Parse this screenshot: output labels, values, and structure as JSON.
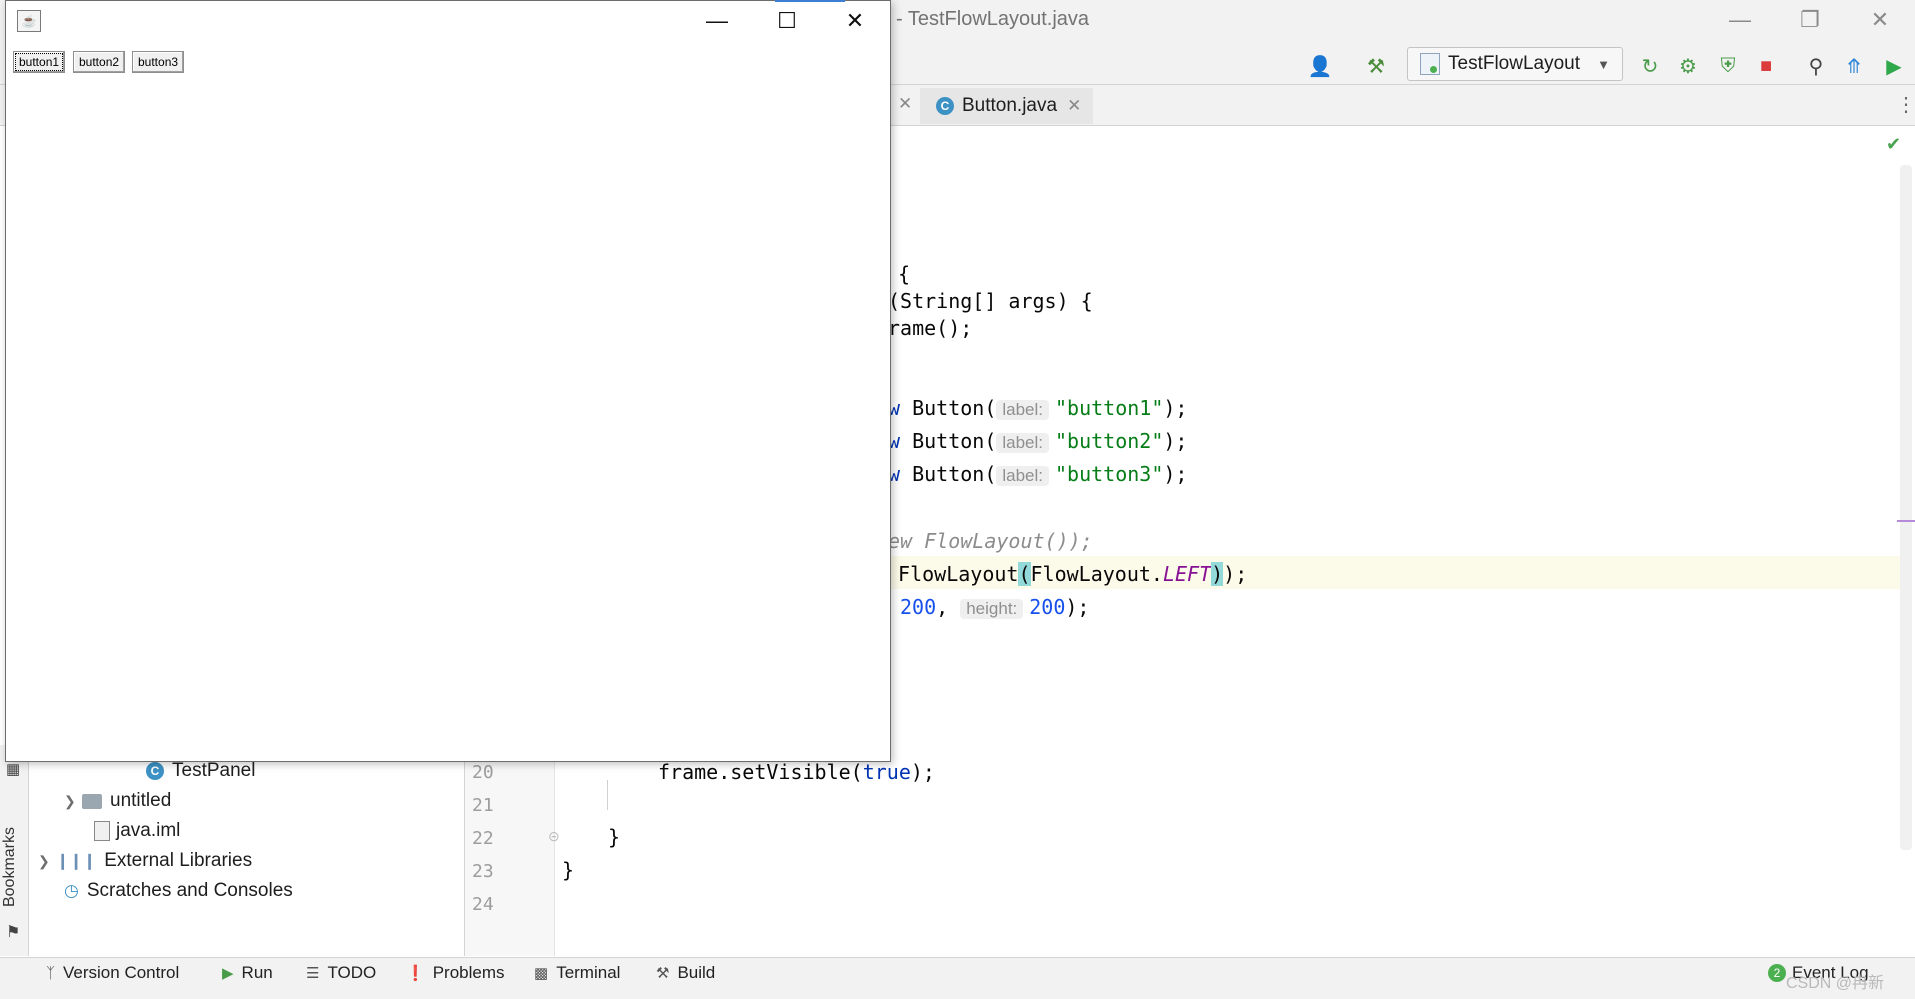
{
  "ide": {
    "title": "- TestFlowLayout.java",
    "run_config": "TestFlowLayout",
    "tab_label": "Button.java",
    "tab_icon": "C"
  },
  "code_lines": {
    "l1": "{",
    "l2": "(String[] args) {",
    "l3": "rame();",
    "b1_pre": "w",
    "b1_call": " Button(",
    "b1_hint": "label:",
    "b1_str": "\"button1\"",
    "b1_end": ");",
    "b2_pre": "w",
    "b2_call": " Button(",
    "b2_hint": "label:",
    "b2_str": "\"button2\"",
    "b2_end": ");",
    "b3_pre": "w",
    "b3_call": " Button(",
    "b3_hint": "label:",
    "b3_str": "\"button3\"",
    "b3_end": ");",
    "comment": "ew FlowLayout());",
    "fl_call": " FlowLayout",
    "fl_open": "(",
    "fl_arg": "FlowLayout.",
    "fl_const": "LEFT",
    "fl_close": ")",
    "fl_end": ");",
    "sz_num1": "200",
    "sz_sep": ", ",
    "sz_hint": "height:",
    "sz_num2": "200",
    "sz_end": ");",
    "vis_pre": "frame.setVisible(",
    "vis_kw": "true",
    "vis_end": ");",
    "close_inner": "}",
    "close_outer": "}"
  },
  "line_numbers": [
    "20",
    "21",
    "22",
    "23",
    "24"
  ],
  "project_tree": {
    "test_panel": "TestPanel",
    "untitled": "untitled",
    "java_iml": "java.iml",
    "external_libraries": "External Libraries",
    "scratches": "Scratches and Consoles"
  },
  "left_stripe": {
    "bookmarks": "Bookmarks"
  },
  "bottom_bar": {
    "version_control": "Version Control",
    "run": "Run",
    "todo": "TODO",
    "problems": "Problems",
    "terminal": "Terminal",
    "build": "Build",
    "event_log": "Event Log",
    "event_count": "2"
  },
  "java_frame": {
    "buttons": [
      "button1",
      "button2",
      "button3"
    ]
  },
  "watermark": "CSDN @冉新",
  "colors": {
    "string": "#067d17",
    "keyword": "#0033b3",
    "number": "#1750eb",
    "static_field": "#871094",
    "current_line": "#fcfae8"
  }
}
